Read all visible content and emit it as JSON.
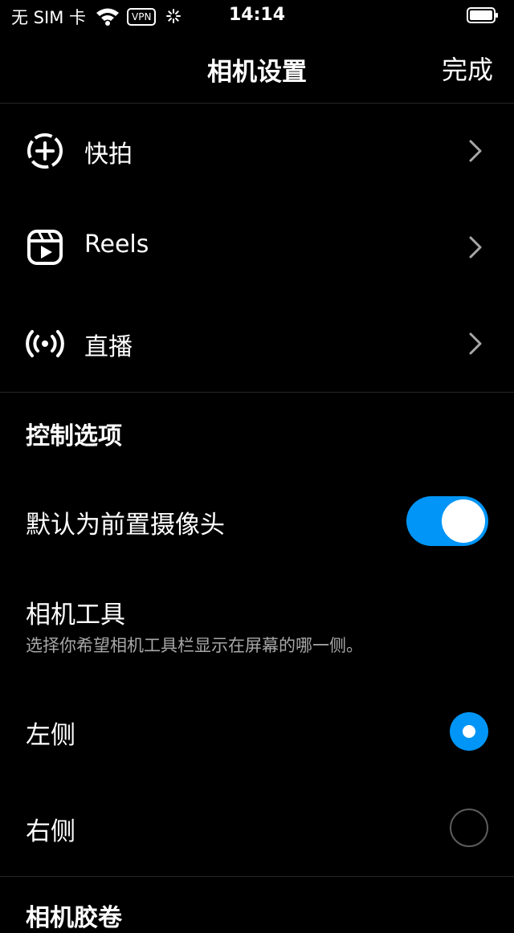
{
  "status_bar": {
    "carrier": "无 SIM 卡",
    "vpn": "VPN",
    "time": "14:14"
  },
  "nav": {
    "title": "相机设置",
    "done": "完成"
  },
  "menu": [
    {
      "label": "快拍",
      "icon": "story-plus-icon"
    },
    {
      "label": "Reels",
      "icon": "reels-icon"
    },
    {
      "label": "直播",
      "icon": "live-broadcast-icon"
    }
  ],
  "controls": {
    "title": "控制选项",
    "front_camera": {
      "label": "默认为前置摄像头",
      "enabled": true
    },
    "camera_tools": {
      "title": "相机工具",
      "subtitle": "选择你希望相机工具栏显示在屏幕的哪一侧。",
      "options": [
        {
          "label": "左侧",
          "selected": true
        },
        {
          "label": "右侧",
          "selected": false
        }
      ]
    }
  },
  "next_section": {
    "title": "相机胶卷"
  },
  "colors": {
    "accent": "#0095f6",
    "background": "#000000",
    "divider": "#262626",
    "secondary_text": "#a8a8a8"
  }
}
